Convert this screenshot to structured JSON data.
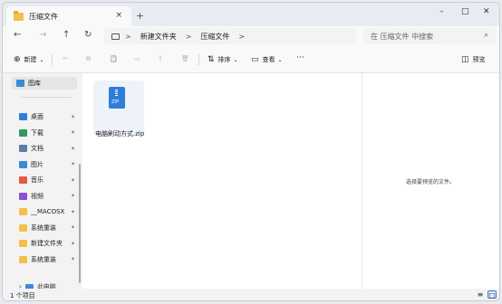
{
  "window": {
    "tab_title": "压缩文件",
    "tab_close": "×",
    "new_tab": "+",
    "minimize": "–",
    "maximize": "□",
    "close": "✕"
  },
  "nav": {
    "back": "←",
    "forward": "→",
    "up": "↑",
    "refresh": "↻",
    "breadcrumb": [
      "新建文件夹",
      "压缩文件"
    ],
    "chevron": ">",
    "search_placeholder": "在 压缩文件 中搜索",
    "search_icon": "⌕"
  },
  "toolbar": {
    "new_label": "新建",
    "sort_label": "排序",
    "view_label": "查看",
    "more": "···",
    "preview_label": "预览"
  },
  "sidebar": {
    "gallery": "图库",
    "items": [
      {
        "label": "桌面",
        "color": "#2f7ed8"
      },
      {
        "label": "下载",
        "color": "#2f9a5b"
      },
      {
        "label": "文档",
        "color": "#5a7fa6"
      },
      {
        "label": "图片",
        "color": "#3a8ad6"
      },
      {
        "label": "音乐",
        "color": "#e35b3e"
      },
      {
        "label": "视频",
        "color": "#8a4fd8"
      },
      {
        "label": "__MACOSX",
        "color": "#f4c04a"
      },
      {
        "label": "系统重装",
        "color": "#f4c04a"
      },
      {
        "label": "新建文件夹",
        "color": "#f4c04a"
      },
      {
        "label": "系统重装",
        "color": "#f4c04a"
      }
    ],
    "pin": "📌",
    "partial_item": "此电脑",
    "expand": "›"
  },
  "content": {
    "file_name": "电脑刷动方式.zip",
    "zip_badge": "ZIP"
  },
  "preview": {
    "empty_text": "选择要预览的文件。"
  },
  "status": {
    "item_count": "1 个项目",
    "details_icon": "≡",
    "tiles_icon": "□"
  }
}
